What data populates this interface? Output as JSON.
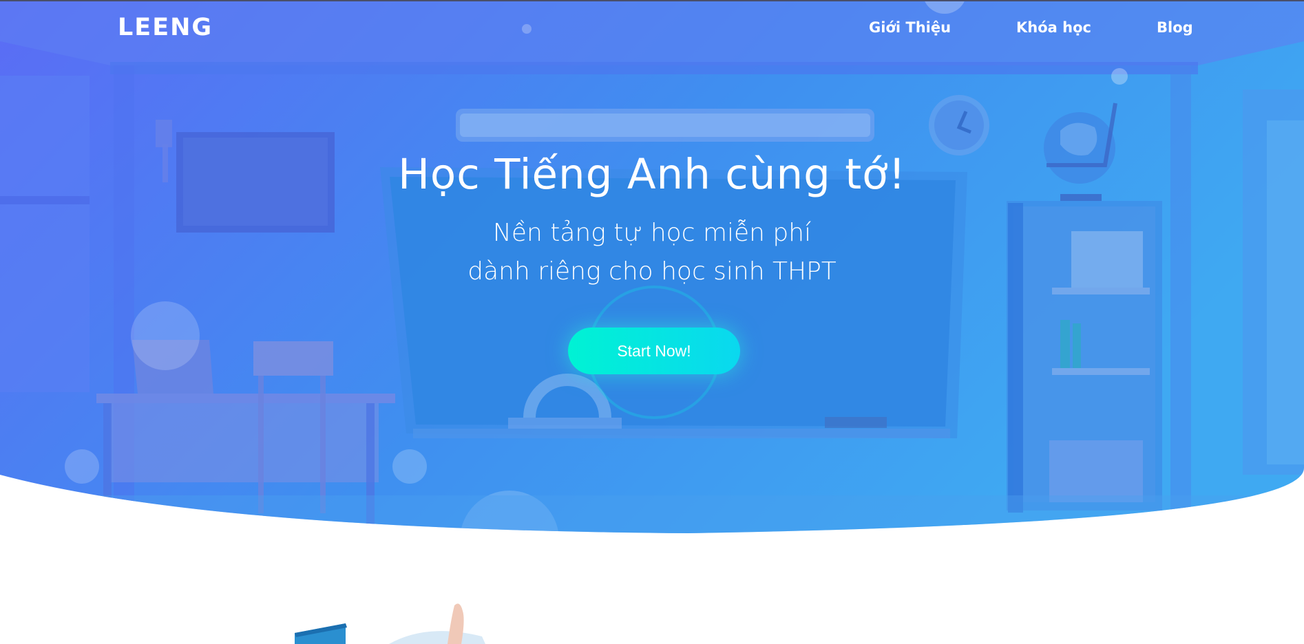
{
  "brand": {
    "logo_text": "LEENG"
  },
  "nav": {
    "items": [
      {
        "label": "Giới Thiệu"
      },
      {
        "label": "Khóa học"
      },
      {
        "label": "Blog"
      }
    ]
  },
  "hero": {
    "title": "Học Tiếng Anh cùng tớ!",
    "subtitle_line1": "Nền tảng tự học miễn phí",
    "subtitle_line2": "dành riêng cho học sinh THPT",
    "cta_label": "Start Now!"
  },
  "colors": {
    "hero_gradient_start": "#5b6cf5",
    "hero_gradient_end": "#3fa9f2",
    "cta_start": "#00f2d4",
    "cta_end": "#0ad8ef",
    "text": "#ffffff"
  }
}
